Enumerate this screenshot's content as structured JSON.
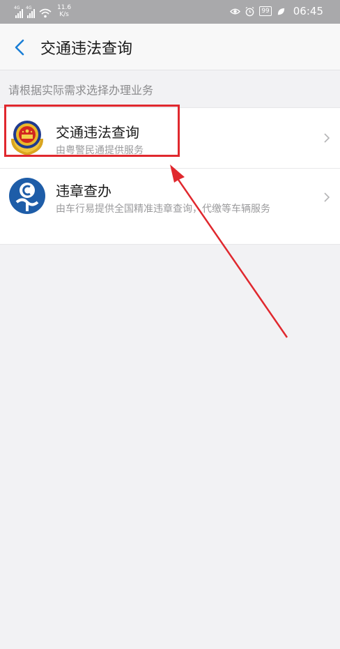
{
  "status_bar": {
    "net1": "4G",
    "net2": "4G",
    "speed_value": "11.6",
    "speed_unit": "K/s",
    "battery": "99",
    "time": "06:45"
  },
  "header": {
    "title": "交通违法查询"
  },
  "hint": "请根据实际需求选择办理业务",
  "items": [
    {
      "title": "交通违法查询",
      "subtitle": "由粤警民通提供服务"
    },
    {
      "title": "违章查办",
      "subtitle": "由车行易提供全国精准违章查询，代缴等车辆服务"
    }
  ],
  "colors": {
    "accent": "#1a7fd6",
    "highlight": "#e0282e",
    "status_bar": "#a9a9ab"
  }
}
